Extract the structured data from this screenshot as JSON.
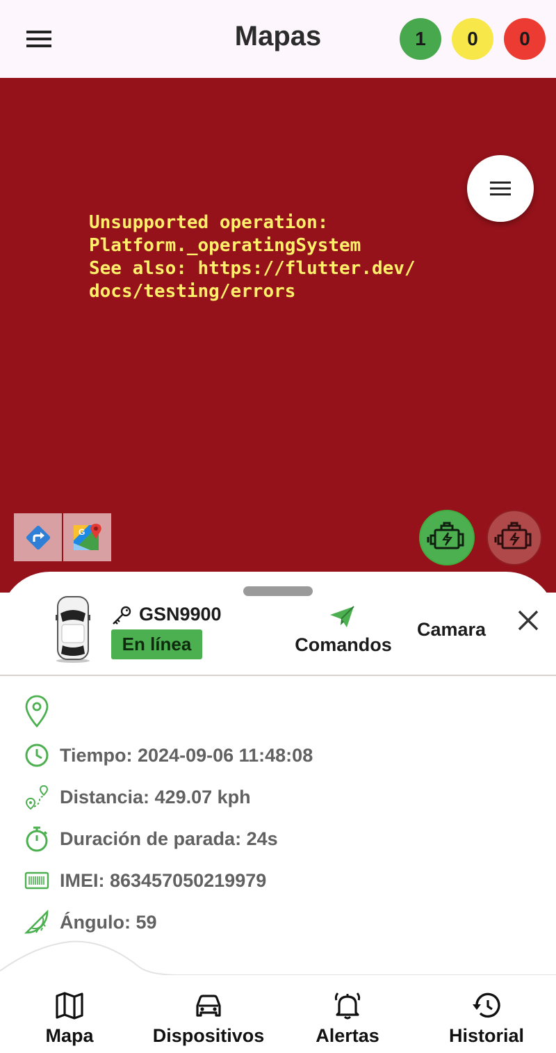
{
  "header": {
    "title": "Mapas",
    "counters": [
      {
        "value": "1",
        "color": "#48a84e"
      },
      {
        "value": "0",
        "color": "#f7e748"
      },
      {
        "value": "0",
        "color": "#ec3b32"
      }
    ]
  },
  "map": {
    "background_color": "#95121a",
    "error_message": "Unsupported operation:\nPlatform._operatingSystem\nSee also: https://flutter.dev/\ndocs/testing/errors"
  },
  "vehicle": {
    "plate": "GSN9900",
    "status": "En línea",
    "commands_label": "Comandos",
    "camera_label": "Camara"
  },
  "details": {
    "location": "",
    "time": "Tiempo: 2024-09-06 11:48:08",
    "distance": "Distancia: 429.07 kph",
    "stop_duration": "Duración de parada: 24s",
    "imei": "IMEI: 863457050219979",
    "angle": "Ángulo: 59"
  },
  "nav": {
    "items": [
      {
        "label": "Mapa",
        "icon": "map-icon"
      },
      {
        "label": "Dispositivos",
        "icon": "car-icon"
      },
      {
        "label": "Alertas",
        "icon": "bell-icon"
      },
      {
        "label": "Historial",
        "icon": "history-icon"
      }
    ]
  },
  "colors": {
    "accent_green": "#4caf50",
    "app_bar_bg": "#fdf7fd",
    "error_text": "#ffef6a"
  }
}
